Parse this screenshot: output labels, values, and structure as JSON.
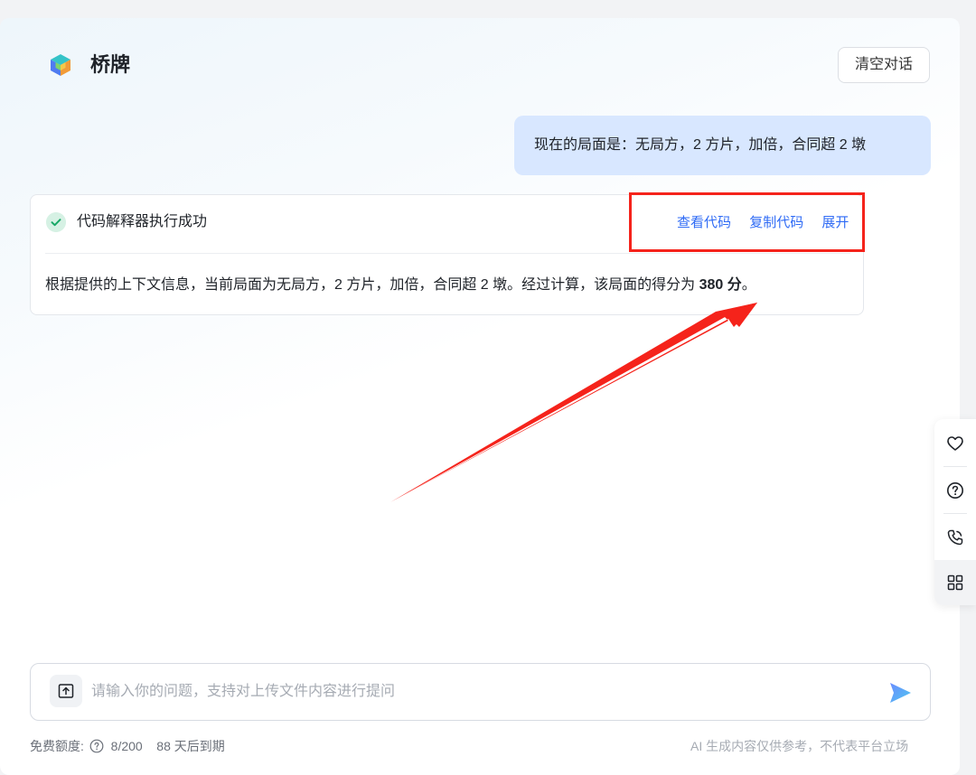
{
  "app": {
    "title": "桥牌",
    "clear_label": "清空对话"
  },
  "conversation": {
    "user_message": "现在的局面是：无局方，2 方片，加倍，合同超 2 墩",
    "tool_status": "代码解释器执行成功",
    "actions": {
      "view_code": "查看代码",
      "copy_code": "复制代码",
      "expand": "展开"
    },
    "answer_prefix": "根据提供的上下文信息，当前局面为无局方，2 方片，加倍，合同超 2 墩。经过计算，该局面的得分为 ",
    "answer_score": "380 分",
    "answer_suffix": "。"
  },
  "input": {
    "placeholder": "请输入你的问题，支持对上传文件内容进行提问",
    "value": ""
  },
  "footer": {
    "quota_label": "免费额度:",
    "quota_usage": "8/200",
    "expiry": "88 天后到期",
    "disclaimer": "AI 生成内容仅供参考，不代表平台立场"
  },
  "side_rail": {
    "icons": [
      "heart-icon",
      "help-icon",
      "phone-icon",
      "apps-grid-icon"
    ]
  },
  "colors": {
    "accent": "#2f6bf5",
    "user_bubble": "#d8e7ff",
    "annotation_red": "#f5231b",
    "success_green": "#19a867"
  }
}
